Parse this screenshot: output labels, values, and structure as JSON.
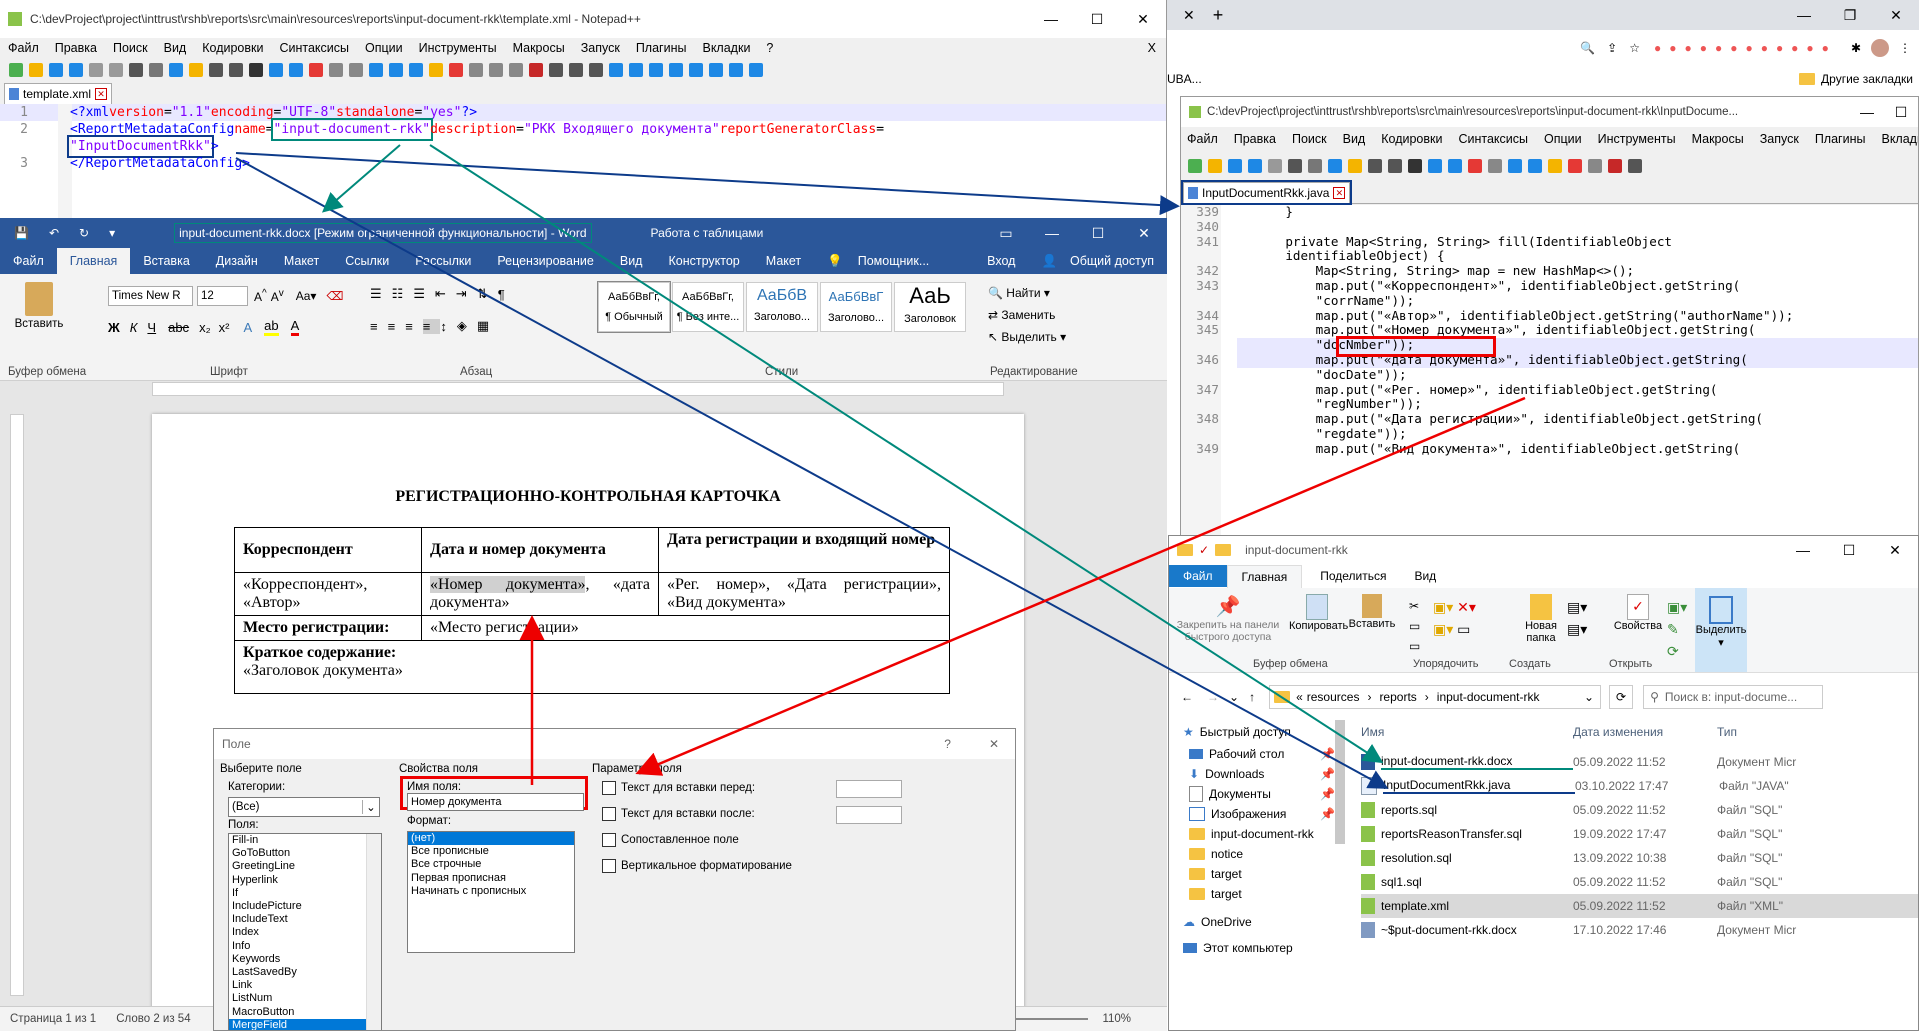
{
  "npp_left": {
    "title": "C:\\devProject\\project\\inttrust\\rshb\\reports\\src\\main\\resources\\reports\\input-document-rkk\\template.xml - Notepad++",
    "menu": [
      "Файл",
      "Правка",
      "Поиск",
      "Вид",
      "Кодировки",
      "Синтаксисы",
      "Опции",
      "Инструменты",
      "Макросы",
      "Запуск",
      "Плагины",
      "Вкладки",
      "?"
    ],
    "close_x": "X",
    "tab": "template.xml",
    "lines": [
      "1",
      "2",
      "3"
    ],
    "l1": {
      "a": "<?",
      "b": "xml",
      "c": " version",
      "d": "=",
      "e": "\"1.1\"",
      "f": " encoding",
      "g": "=",
      "h": "\"UTF-8\"",
      "i": " standalone",
      "j": "=",
      "k": "\"yes\"",
      "l": "?>"
    },
    "l2": {
      "a": "<ReportMetadataConfig",
      "b": " name",
      "c": "=",
      "d": "\"input-document-rkk\"",
      "e": " description",
      "f": "=",
      "g": "\"РКК Входящего документа\"",
      "h": " reportGeneratorClass",
      "i": "="
    },
    "l2b": "\"InputDocumentRkk\"",
    "l2c": ">",
    "l3": "</ReportMetadataConfig>"
  },
  "word": {
    "title": "input-document-rkk.docx [Режим ограниченной функциональности] - Word",
    "table_tools": "Работа с таблицами",
    "tabs": [
      "Файл",
      "Главная",
      "Вставка",
      "Дизайн",
      "Макет",
      "Ссылки",
      "Рассылки",
      "Рецензирование",
      "Вид",
      "Конструктор",
      "Макет"
    ],
    "tell_me": "Помощник...",
    "signin": "Вход",
    "share": "Общий доступ",
    "paste": "Вставить",
    "font_name": "Times New R",
    "font_size": "12",
    "styles": [
      {
        "sample": "АаБбВвГг,",
        "name": "¶ Обычный"
      },
      {
        "sample": "АаБбВвГг,",
        "name": "¶ Без инте..."
      },
      {
        "sample": "АаБбВ",
        "name": "Заголово..."
      },
      {
        "sample": "АаБбВвГ",
        "name": "Заголово..."
      },
      {
        "sample": "АаЬ",
        "name": "Заголовок"
      }
    ],
    "find": "Найти",
    "replace": "Заменить",
    "select": "Выделить",
    "groups": [
      "Буфер обмена",
      "Шрифт",
      "Абзац",
      "Стили",
      "Редактирование"
    ],
    "doc_title": "РЕГИСТРАЦИОННО-КОНТРОЛЬНАЯ КАРТОЧКА",
    "table": {
      "h1": "Корреспондент",
      "h2": "Дата и номер документа",
      "h3": "Дата регистрации и входящий номер",
      "c1": "«Корреспондент», «Автор»",
      "c2a": "«Номер документа»",
      "c2b": ", «дата документа»",
      "c3": "«Рег. номер», «Дата регистрации», «Вид документа»",
      "place_label": "Место регистрации:",
      "place_val": "«Место регистрации»",
      "summary_label": "Краткое содержание:",
      "summary_val": "«Заголовок документа»"
    },
    "status_page": "Страница 1 из 1",
    "status_words": "Слово 2 из 54",
    "zoom": "110%"
  },
  "dialog": {
    "title": "Поле",
    "help": "?",
    "close": "✕",
    "choose_field": "Выберите поле",
    "categories_label": "Категории:",
    "category_value": "(Все)",
    "fields_label": "Поля:",
    "fields": [
      "Fill-in",
      "GoToButton",
      "GreetingLine",
      "Hyperlink",
      "If",
      "IncludePicture",
      "IncludeText",
      "Index",
      "Info",
      "Keywords",
      "LastSavedBy",
      "Link",
      "ListNum",
      "MacroButton",
      "MergeField"
    ],
    "props": "Свойства поля",
    "field_name_label": "Имя поля:",
    "field_name_value": "Номер документа",
    "format_label": "Формат:",
    "formats": [
      "(нет)",
      "Все прописные",
      "Все строчные",
      "Первая прописная",
      "Начинать с прописных"
    ],
    "params": "Параметры поля",
    "opt1": "Текст для вставки перед:",
    "opt2": "Текст для вставки после:",
    "opt3": "Сопоставленное поле",
    "opt4": "Вертикальное форматирование"
  },
  "chrome": {
    "bookmarks_tail": "UBA...",
    "other_bookmarks": "Другие закладки"
  },
  "npp_right": {
    "title": "C:\\devProject\\project\\inttrust\\rshb\\reports\\src\\main\\resources\\reports\\input-document-rkk\\InputDocume...",
    "menu": [
      "Файл",
      "Правка",
      "Поиск",
      "Вид",
      "Кодировки",
      "Синтаксисы",
      "Опции",
      "Инструменты",
      "Макросы",
      "Запуск",
      "Плагины",
      "Вкладки"
    ],
    "tab": "InputDocumentRkk.java",
    "lines": [
      {
        "n": "339",
        "t": "    }"
      },
      {
        "n": "340",
        "t": ""
      },
      {
        "n": "341",
        "t": "    private Map<String, String> fill(IdentifiableObject"
      },
      {
        "n": "",
        "t": "    identifiableObject) {"
      },
      {
        "n": "342",
        "t": "        Map<String, String> map = new HashMap<>();"
      },
      {
        "n": "343",
        "t": "        map.put(\"«Корреспондент»\", identifiableObject.getString("
      },
      {
        "n": "",
        "t": "        \"corrName\"));"
      },
      {
        "n": "344",
        "t": "        map.put(\"«Автор»\", identifiableObject.getString(\"authorName\"));"
      },
      {
        "n": "345",
        "t": "        map.put(\"«Номер документа»\", identifiableObject.getString("
      },
      {
        "n": "",
        "t": "        \"docNmber\"));"
      },
      {
        "n": "346",
        "t": "        map.put(\"«дата документа»\", identifiableObject.getString("
      },
      {
        "n": "",
        "t": "        \"docDate\"));"
      },
      {
        "n": "347",
        "t": "        map.put(\"«Рег. номер»\", identifiableObject.getString("
      },
      {
        "n": "",
        "t": "        \"regNumber\"));"
      },
      {
        "n": "348",
        "t": "        map.put(\"«Дата регистрации»\", identifiableObject.getString("
      },
      {
        "n": "",
        "t": "        \"regdate\"));"
      },
      {
        "n": "349",
        "t": "        map.put(\"«Вид документа»\", identifiableObject.getString("
      }
    ]
  },
  "explorer": {
    "title": "input-document-rkk",
    "tabs": [
      "Файл",
      "Главная",
      "Поделиться",
      "Вид"
    ],
    "ribbon": [
      {
        "label": "Закрепить на панели быстрого доступа"
      },
      {
        "label": "Копировать"
      },
      {
        "label": "Вставить"
      },
      {
        "label": "Новая папка"
      },
      {
        "label": "Свойства"
      },
      {
        "label": "Выделить"
      }
    ],
    "groups": [
      "Буфер обмена",
      "Упорядочить",
      "Создать",
      "Открыть"
    ],
    "path": [
      "resources",
      "reports",
      "input-document-rkk"
    ],
    "search": "Поиск в: input-docume...",
    "cols": [
      "Имя",
      "Дата изменения",
      "Тип"
    ],
    "nav": [
      {
        "name": "Быстрый доступ"
      },
      {
        "name": "Рабочий стол"
      },
      {
        "name": "Downloads"
      },
      {
        "name": "Документы"
      },
      {
        "name": "Изображения"
      },
      {
        "name": "input-document-rkk"
      },
      {
        "name": "notice"
      },
      {
        "name": "target"
      },
      {
        "name": "target"
      },
      {
        "name": "OneDrive"
      },
      {
        "name": "Этот компьютер"
      }
    ],
    "files": [
      {
        "name": "input-document-rkk.docx",
        "date": "05.09.2022 11:52",
        "type": "Документ Micr"
      },
      {
        "name": "InputDocumentRkk.java",
        "date": "03.10.2022 17:47",
        "type": "Файл \"JAVA\""
      },
      {
        "name": "reports.sql",
        "date": "05.09.2022 11:52",
        "type": "Файл \"SQL\""
      },
      {
        "name": "reportsReasonTransfer.sql",
        "date": "19.09.2022 17:47",
        "type": "Файл \"SQL\""
      },
      {
        "name": "resolution.sql",
        "date": "13.09.2022 10:38",
        "type": "Файл \"SQL\""
      },
      {
        "name": "sql1.sql",
        "date": "05.09.2022 11:52",
        "type": "Файл \"SQL\""
      },
      {
        "name": "template.xml",
        "date": "05.09.2022 11:52",
        "type": "Файл \"XML\""
      },
      {
        "name": "~$put-document-rkk.docx",
        "date": "17.10.2022 17:46",
        "type": "Документ Micr"
      }
    ]
  }
}
